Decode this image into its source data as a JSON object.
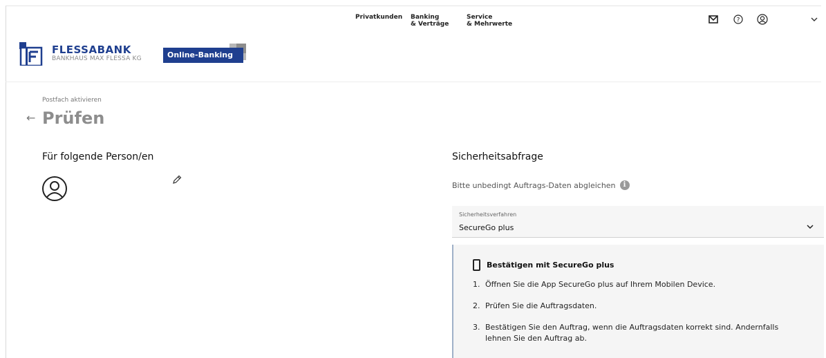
{
  "nav": {
    "items": [
      {
        "line1": "Privatkunden",
        "line2": ""
      },
      {
        "line1": "Banking",
        "line2": "& Verträge"
      },
      {
        "line1": "Service",
        "line2": "& Mehrwerte"
      }
    ]
  },
  "header_icons": [
    "mail-icon",
    "help-icon",
    "user-icon",
    "chevron-down-icon"
  ],
  "brand": {
    "name": "FLESSABANK",
    "subtitle": "BANKHAUS MAX FLESSA KG",
    "online_banking_label": "Online-Banking",
    "primary_color": "#1f3f8f"
  },
  "page": {
    "breadcrumb": "Postfach aktivieren",
    "title": "Prüfen"
  },
  "left": {
    "title": "Für folgende Person/en"
  },
  "right": {
    "title": "Sicherheitsabfrage",
    "hint": "Bitte unbedingt Auftrags-Daten abgleichen",
    "select": {
      "label": "Sicherheitsverfahren",
      "value": "SecureGo plus"
    },
    "panel": {
      "heading": "Bestätigen mit SecureGo plus",
      "steps": [
        {
          "num": "1.",
          "text": "Öffnen Sie die App SecureGo plus auf Ihrem Mobilen Device."
        },
        {
          "num": "2.",
          "text": "Prüfen Sie die Auftragsdaten."
        },
        {
          "num": "3.",
          "text": "Bestätigen Sie den Auftrag, wenn die Auftragsdaten korrekt sind. Andernfalls lehnen Sie den Auftrag ab."
        }
      ]
    }
  }
}
